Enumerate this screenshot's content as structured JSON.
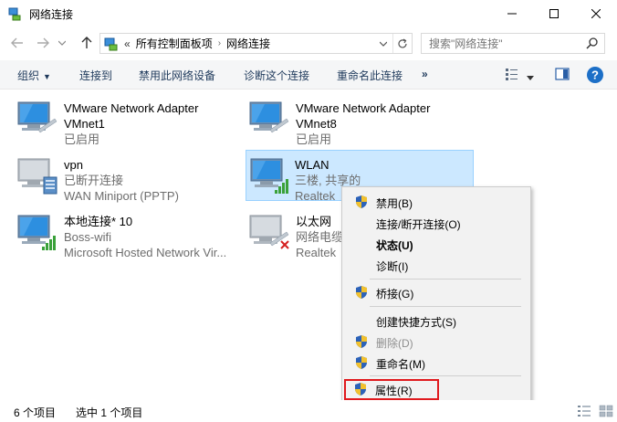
{
  "window": {
    "title": "网络连接",
    "minimize_icon": "minimize-icon",
    "maximize_icon": "maximize-icon",
    "close_icon": "close-icon"
  },
  "address": {
    "prefix": "«",
    "crumbs": [
      "所有控制面板项",
      "网络连接"
    ],
    "search_placeholder": "搜索\"网络连接\""
  },
  "commands": {
    "organize": "组织",
    "connect_to": "连接到",
    "disable_device": "禁用此网络设备",
    "diagnose": "诊断这个连接",
    "rename": "重命名此连接",
    "more": "»"
  },
  "items": [
    {
      "name": "VMware Network Adapter",
      "line2": "VMnet1",
      "line3": "已启用",
      "icon": "network-adapter-icon"
    },
    {
      "name": "VMware Network Adapter",
      "line2": "VMnet8",
      "line3": "已启用",
      "icon": "network-adapter-icon"
    },
    {
      "name": "vpn",
      "line2": "已断开连接",
      "line3": "WAN Miniport (PPTP)",
      "icon": "vpn-connection-icon"
    },
    {
      "name": "WLAN",
      "line2": "三楼, 共享的",
      "line3": "Realtek",
      "icon": "wireless-adapter-icon"
    },
    {
      "name": "本地连接* 10",
      "line2": "Boss-wifi",
      "line3": "Microsoft Hosted Network Vir...",
      "icon": "wireless-adapter-icon"
    },
    {
      "name": "以太网",
      "line2": "网络电缆被拔出",
      "line3": "Realtek",
      "icon": "ethernet-adapter-icon"
    }
  ],
  "context_menu": {
    "items": [
      {
        "label": "禁用(B)",
        "shield": true
      },
      {
        "label": "连接/断开连接(O)",
        "shield": false
      },
      {
        "label": "状态(U)",
        "shield": false,
        "bold": true
      },
      {
        "label": "诊断(I)",
        "shield": false
      },
      {
        "label": "桥接(G)",
        "shield": true
      },
      {
        "label": "创建快捷方式(S)",
        "shield": false
      },
      {
        "label": "删除(D)",
        "shield": true,
        "disabled": true
      },
      {
        "label": "重命名(M)",
        "shield": true
      },
      {
        "label": "属性(R)",
        "shield": true,
        "highlighted": true
      }
    ]
  },
  "status": {
    "count": "6 个项目",
    "selected": "选中 1 个项目"
  },
  "colors": {
    "selection_bg": "#cce8ff",
    "selection_border": "#99d1ff",
    "highlight_red": "#e0191d",
    "command_text": "#1e395b",
    "help_blue": "#1c6fc7"
  }
}
